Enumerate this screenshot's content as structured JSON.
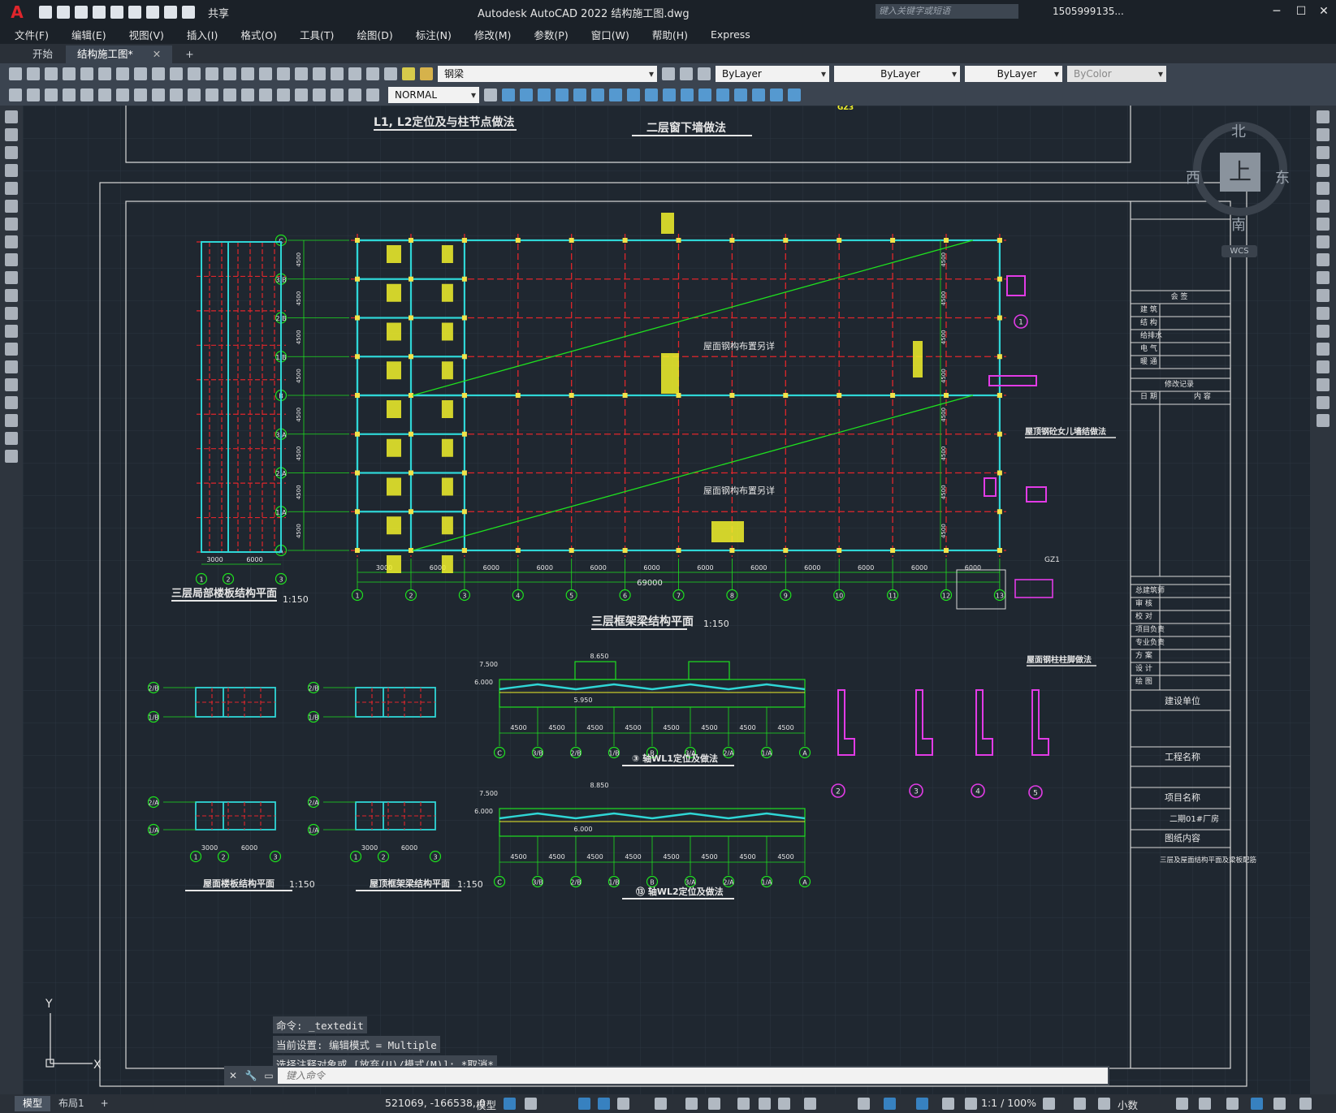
{
  "app": {
    "logo": "A",
    "title": "Autodesk AutoCAD 2022    结构施工图.dwg",
    "share_label": "共享",
    "search_placeholder": "键入关键字或短语",
    "user": "1505999135...",
    "help": "?"
  },
  "window_buttons": {
    "minimize": "─",
    "maximize": "☐",
    "close": "✕"
  },
  "menu": [
    "文件(F)",
    "编辑(E)",
    "视图(V)",
    "插入(I)",
    "格式(O)",
    "工具(T)",
    "绘图(D)",
    "标注(N)",
    "修改(M)",
    "参数(P)",
    "窗口(W)",
    "帮助(H)",
    "Express"
  ],
  "doc_tabs": [
    {
      "label": "开始",
      "active": false
    },
    {
      "label": "结构施工图*",
      "active": true
    }
  ],
  "doc_tab_close": "✕",
  "doc_tab_add": "+",
  "toolbar": {
    "layer_combo": "钢梁",
    "color_combo": "ByLayer",
    "linetype_combo": "ByLayer",
    "lineweight_combo": "ByLayer",
    "plotstyle_combo": "ByColor",
    "textstyle_combo": "NORMAL"
  },
  "viewcube": {
    "face": "上",
    "north": "北",
    "south": "南",
    "east": "东",
    "west": "西",
    "wcs": "WCS"
  },
  "drawing": {
    "top_titles": [
      "L1, L2定位及与柱节点做法",
      "二层窗下墙做法"
    ],
    "plan_titles": {
      "local_plan": "三层局部楼板结构平面",
      "local_scale": "1:150",
      "frame_plan": "三层框架梁结构平面",
      "frame_scale": "1:150",
      "roof_slab": "屋面楼板结构平面",
      "roof_slab_scale": "1:150",
      "roof_frame": "屋顶框架梁结构平面",
      "roof_frame_scale": "1:150",
      "ridge1": "③ 轴WL1定位及做法",
      "ridge2": "⑬ 轴WL2定位及做法",
      "parapet": "屋顶钢砼女儿墙结做法",
      "steel_col": "屋面钢柱柱脚做法"
    },
    "plan_notes": [
      "屋面钢构布置另详",
      "屋面钢构布置另详"
    ],
    "top_axes": [
      "C",
      "3/B",
      "2/B",
      "1/B",
      "B",
      "3/A",
      "2/A",
      "1/A",
      "A"
    ],
    "bottom_axes": [
      "1",
      "2",
      "3",
      "4",
      "5",
      "6",
      "7",
      "8",
      "9",
      "10",
      "11",
      "12",
      "13"
    ],
    "total_dim": "69000",
    "bay_dims": [
      "3000",
      "6000",
      "6000",
      "6000",
      "6000",
      "6000",
      "6000",
      "6000",
      "6000",
      "6000",
      "6000",
      "6000"
    ],
    "row_dims": [
      "4500",
      "4500",
      "4500",
      "4500",
      "4500",
      "4500",
      "4500",
      "4500"
    ],
    "ridge_dims": [
      "4500",
      "4500",
      "4500",
      "4500",
      "4500",
      "4500",
      "4500",
      "4500"
    ],
    "ridge_axes": [
      "C",
      "3/B",
      "2/B",
      "1/B",
      "B",
      "3/A",
      "2/A",
      "1/A",
      "A"
    ],
    "elev_labels": [
      "7.500",
      "8.650",
      "8.850",
      "6.000",
      "5.950",
      "7.500",
      "8.850",
      "6.000"
    ],
    "local_dims": [
      "3000",
      "6000"
    ],
    "local_axes": [
      "1",
      "2",
      "3"
    ],
    "gz_label": "GZ1",
    "gz_label_top": "GZ3",
    "title_block": {
      "sign": "会 签",
      "roles": [
        "建 筑",
        "结 构",
        "给排水",
        "电 气",
        "暖 通"
      ],
      "revision": "修改记录",
      "rev_cols": [
        "日 期",
        "内 容"
      ],
      "approve": [
        "总建筑师",
        "审 核",
        "校 对",
        "项目负责",
        "专业负责",
        "方 案",
        "设 计",
        "绘 图"
      ],
      "unit": "建设单位",
      "project": "工程名称",
      "item": "项目名称",
      "item_value": "二期01#厂房",
      "content": "图纸内容",
      "content_value": "三层及屋面结构平面及梁板配筋"
    },
    "detail_circles": [
      "1",
      "2",
      "3",
      "4",
      "5"
    ]
  },
  "command": {
    "history": [
      "命令: _textedit",
      "当前设置: 编辑模式 = Multiple",
      "选择注释对象或 [放弃(U)/模式(M)]: *取消*"
    ],
    "placeholder": "键入命令"
  },
  "ucs": {
    "x": "X",
    "y": "Y"
  },
  "status": {
    "layout_tabs": [
      {
        "label": "模型",
        "active": true
      },
      {
        "label": "布局1",
        "active": false
      }
    ],
    "add_layout": "+",
    "coords": "521069, -166538, 0",
    "model": "模型",
    "scale": "1:1 / 100%",
    "units": "小数"
  },
  "colors": {
    "canvas": "#1f2730",
    "axis_red": "#e0262b",
    "column_cyan": "#2fd6d6",
    "dim_green": "#1fe01f",
    "text_yellow": "#f2f22a",
    "magenta": "#e23be6",
    "frame_white": "#d8d8d8"
  }
}
